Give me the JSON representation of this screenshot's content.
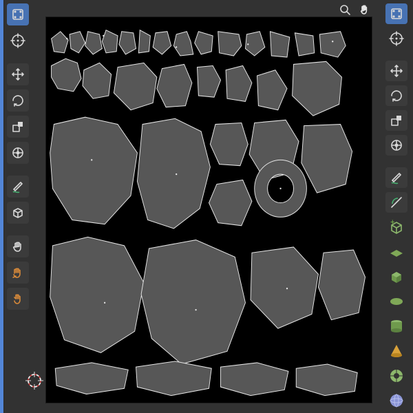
{
  "app": "Blender",
  "panels": {
    "left": "UV Editor",
    "right": "3D Viewport"
  },
  "left_header": {
    "mode_icon": "uv-select-mode",
    "cursor_icon": "uv-cursor"
  },
  "left_toolbar": [
    {
      "id": "move-tool",
      "icon": "move-arrows",
      "label": "Move",
      "active": false
    },
    {
      "id": "rotate-tool",
      "icon": "rotate-arcs",
      "label": "Rotate",
      "active": false
    },
    {
      "id": "scale-tool",
      "icon": "scale-box",
      "label": "Scale",
      "active": false
    },
    {
      "id": "transform-tool",
      "icon": "transform",
      "label": "Transform",
      "active": false
    },
    {
      "id": "annotate-tool",
      "icon": "pencil-wave",
      "label": "Annotate",
      "active": false,
      "group": true
    },
    {
      "id": "cube-tool",
      "icon": "cube",
      "label": "Cube Projection",
      "active": false
    },
    {
      "id": "grab-tool",
      "icon": "hand",
      "label": "Grab",
      "active": false,
      "group": true
    },
    {
      "id": "relax-tool",
      "icon": "relax-hand",
      "label": "Relax",
      "active": false
    },
    {
      "id": "pinch-tool",
      "icon": "pinch-hand",
      "label": "Pinch",
      "active": false
    }
  ],
  "viewport_nav": {
    "zoom_icon": "magnify",
    "pan_icon": "hand"
  },
  "right_header": {
    "mode_icon": "edit-mode-select",
    "cursor_icon": "3d-cursor"
  },
  "right_toolbar": [
    {
      "id": "move-3d",
      "icon": "move-arrows",
      "active": false
    },
    {
      "id": "rotate-3d",
      "icon": "rotate-arcs",
      "active": false
    },
    {
      "id": "scale-3d",
      "icon": "scale-box",
      "active": false
    },
    {
      "id": "transform-3d",
      "icon": "transform",
      "active": false
    },
    {
      "id": "annotate-3d",
      "icon": "pencil-wave",
      "active": false,
      "group": true
    },
    {
      "id": "measure-3d",
      "icon": "ruler-arc",
      "active": false
    }
  ],
  "add_primitives": [
    {
      "id": "add-cube",
      "icon": "cube-outline",
      "color": "#82ab63",
      "plus": true
    },
    {
      "id": "add-plane",
      "icon": "plane",
      "color": "#82ab63"
    },
    {
      "id": "add-box",
      "icon": "box-solid",
      "color": "#82ab63"
    },
    {
      "id": "add-circle",
      "icon": "circle-solid",
      "color": "#82ab63"
    },
    {
      "id": "add-cylinder",
      "icon": "cylinder",
      "color": "#82ab63"
    },
    {
      "id": "add-cone",
      "icon": "cone",
      "color": "#dca33b"
    },
    {
      "id": "add-torus",
      "icon": "torus-slices",
      "color": "#86b56a"
    },
    {
      "id": "add-sphere",
      "icon": "sphere",
      "color": "#8a94d6"
    }
  ],
  "uv_layout": {
    "texture_bounds": [
      0,
      0,
      1,
      1
    ],
    "islands_count_visible": 40,
    "description": "Character UV unwrap: hands/fingers top rows, torso & large shells center, limb strips and small pieces bottom"
  }
}
